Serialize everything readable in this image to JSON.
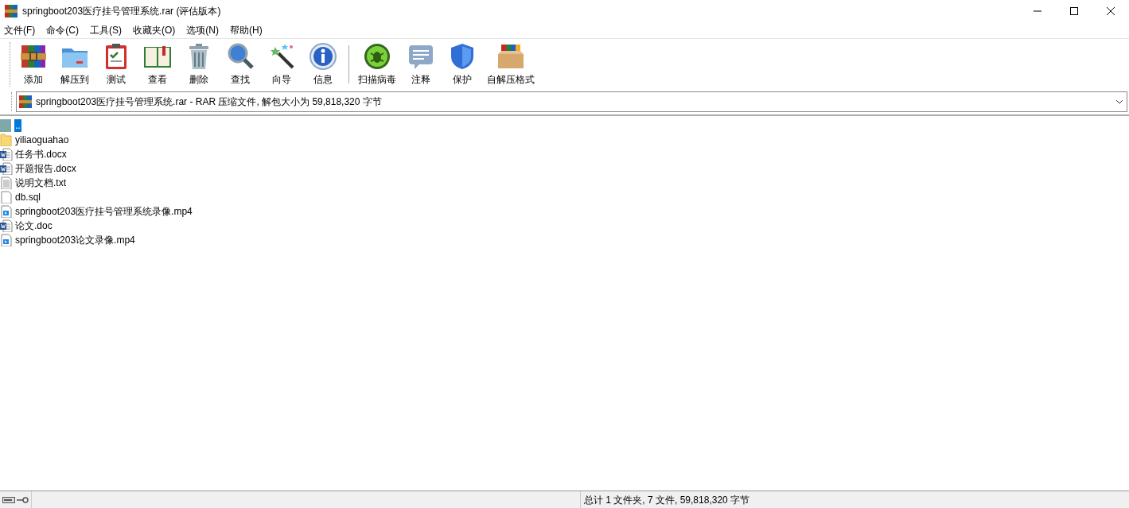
{
  "window": {
    "title": "springboot203医疗挂号管理系统.rar (评估版本)"
  },
  "menu": [
    "文件(F)",
    "命令(C)",
    "工具(S)",
    "收藏夹(O)",
    "选项(N)",
    "帮助(H)"
  ],
  "toolbar": [
    {
      "label": "添加",
      "kind": "books"
    },
    {
      "label": "解压到",
      "kind": "folder"
    },
    {
      "label": "测试",
      "kind": "clipboard"
    },
    {
      "label": "查看",
      "kind": "book"
    },
    {
      "label": "删除",
      "kind": "trash"
    },
    {
      "label": "查找",
      "kind": "magnifier"
    },
    {
      "label": "向导",
      "kind": "wand"
    },
    {
      "label": "信息",
      "kind": "info"
    },
    {
      "label": "扫描病毒",
      "kind": "bug",
      "separator_before": true
    },
    {
      "label": "注释",
      "kind": "note"
    },
    {
      "label": "保护",
      "kind": "shield"
    },
    {
      "label": "自解压格式",
      "kind": "box"
    }
  ],
  "address": {
    "text": "springboot203医疗挂号管理系统.rar - RAR 压缩文件, 解包大小为 59,818,320 字节"
  },
  "files": [
    {
      "name": "..",
      "kind": "up",
      "selected": true
    },
    {
      "name": "yiliaoguahao",
      "kind": "folder",
      "selected": false
    },
    {
      "name": "任务书.docx",
      "kind": "word",
      "selected": false
    },
    {
      "name": "开题报告.docx",
      "kind": "word",
      "selected": false
    },
    {
      "name": "说明文档.txt",
      "kind": "text",
      "selected": false
    },
    {
      "name": "db.sql",
      "kind": "blank",
      "selected": false
    },
    {
      "name": "springboot203医疗挂号管理系统录像.mp4",
      "kind": "video",
      "selected": false
    },
    {
      "name": "论文.doc",
      "kind": "word",
      "selected": false
    },
    {
      "name": "springboot203论文录像.mp4",
      "kind": "video",
      "selected": false
    }
  ],
  "status_bar": {
    "summary": "总计 1 文件夹, 7 文件, 59,818,320 字节"
  }
}
